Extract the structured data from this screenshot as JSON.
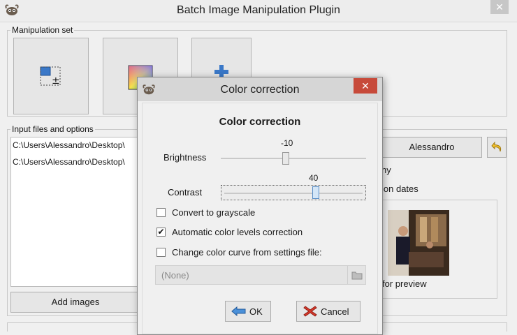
{
  "main": {
    "title": "Batch Image Manipulation Plugin",
    "close_label": "✕",
    "manipulation_set_legend": "Manipulation set",
    "input_legend": "Input files and options",
    "files": [
      "C:\\Users\\Alessandro\\Desktop\\",
      "C:\\Users\\Alessandro\\Desktop\\"
    ],
    "add_images_label": "Add images",
    "user_button_label": "Alessandro",
    "option_text_1": "hy",
    "option_text_2": "ion dates",
    "preview_label": "for preview"
  },
  "dialog": {
    "title": "Color correction",
    "close_label": "✕",
    "heading": "Color correction",
    "brightness": {
      "label": "Brightness",
      "value": "-10",
      "numeric": -10,
      "min": -127,
      "max": 127
    },
    "contrast": {
      "label": "Contrast",
      "value": "40",
      "numeric": 40,
      "min": -127,
      "max": 127
    },
    "checkboxes": [
      {
        "label": "Convert to grayscale",
        "checked": false,
        "mark": ""
      },
      {
        "label": "Automatic color levels correction",
        "checked": true,
        "mark": "✔"
      },
      {
        "label": "Change color curve from settings file:",
        "checked": false,
        "mark": ""
      }
    ],
    "file_chooser_value": "(None)",
    "ok_label": "OK",
    "cancel_label": "Cancel"
  },
  "colors": {
    "close_red": "#c74a3a",
    "slider_focus": "#5b8fc7",
    "add_icon_blue": "#3a78c8"
  },
  "icons": [
    "gimp-logo",
    "resize-icon",
    "color-gradient-icon",
    "plus-icon",
    "undo-icon",
    "folder-icon",
    "ok-arrow-icon",
    "cancel-x-icon"
  ]
}
